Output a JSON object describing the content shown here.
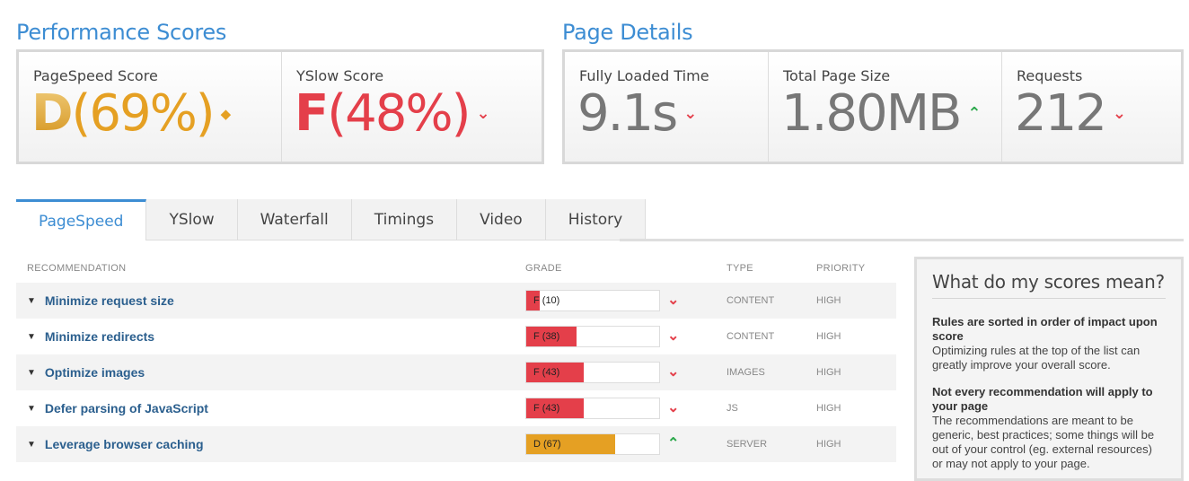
{
  "performance": {
    "title": "Performance Scores",
    "pagespeed": {
      "label": "PageSpeed Score",
      "grade": "D",
      "percent": "(69%)",
      "trend_icon": "diamond-icon",
      "color": "#e5a023"
    },
    "yslow": {
      "label": "YSlow Score",
      "grade": "F",
      "percent": "(48%)",
      "trend_icon": "chevron-down-icon",
      "color": "#e43f4a"
    }
  },
  "details": {
    "title": "Page Details",
    "load_time": {
      "label": "Fully Loaded Time",
      "value": "9.1s",
      "trend_icon": "chevron-down-icon"
    },
    "page_size": {
      "label": "Total Page Size",
      "value": "1.80MB",
      "trend_icon": "chevron-up-icon"
    },
    "requests": {
      "label": "Requests",
      "value": "212",
      "trend_icon": "chevron-down-icon"
    }
  },
  "tabs": [
    "PageSpeed",
    "YSlow",
    "Waterfall",
    "Timings",
    "Video",
    "History"
  ],
  "table": {
    "headers": {
      "recommendation": "RECOMMENDATION",
      "grade": "GRADE",
      "type": "TYPE",
      "priority": "PRIORITY"
    },
    "rows": [
      {
        "name": "Minimize request size",
        "grade_text": "F (10)",
        "score": 10,
        "color": "#e43f4a",
        "trend": "down",
        "type": "CONTENT",
        "priority": "HIGH"
      },
      {
        "name": "Minimize redirects",
        "grade_text": "F (38)",
        "score": 38,
        "color": "#e43f4a",
        "trend": "down",
        "type": "CONTENT",
        "priority": "HIGH"
      },
      {
        "name": "Optimize images",
        "grade_text": "F (43)",
        "score": 43,
        "color": "#e43f4a",
        "trend": "down",
        "type": "IMAGES",
        "priority": "HIGH"
      },
      {
        "name": "Defer parsing of JavaScript",
        "grade_text": "F (43)",
        "score": 43,
        "color": "#e43f4a",
        "trend": "down",
        "type": "JS",
        "priority": "HIGH"
      },
      {
        "name": "Leverage browser caching",
        "grade_text": "D (67)",
        "score": 67,
        "color": "#e5a023",
        "trend": "up",
        "type": "SERVER",
        "priority": "HIGH"
      }
    ]
  },
  "sidebar": {
    "title": "What do my scores mean?",
    "block1_bold": "Rules are sorted in order of impact upon score",
    "block1_text": "Optimizing rules at the top of the list can greatly improve your overall score.",
    "block2_bold": "Not every recommendation will apply to your page",
    "block2_text": "The recommendations are meant to be generic, best practices; some things will be out of your control (eg. external resources) or may not apply to your page."
  },
  "colors": {
    "accent": "#3d8dd3",
    "bad": "#e43f4a",
    "warn": "#e5a023",
    "good": "#2aa84a",
    "big_number": "#777777"
  }
}
